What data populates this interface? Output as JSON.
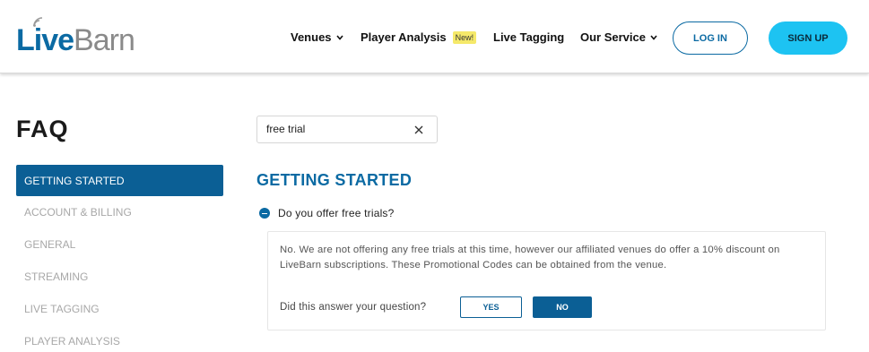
{
  "header": {
    "logo": {
      "part1": "Live",
      "part2": "Barn"
    },
    "nav": [
      {
        "label": "Venues",
        "has_dropdown": true
      },
      {
        "label": "Player Analysis",
        "badge": "New!"
      },
      {
        "label": "Live Tagging"
      },
      {
        "label": "Our Service",
        "has_dropdown": true
      }
    ],
    "login_label": "LOG IN",
    "signup_label": "SIGN UP"
  },
  "faq": {
    "title": "FAQ",
    "menu": [
      {
        "label": "GETTING STARTED",
        "active": true
      },
      {
        "label": "ACCOUNT & BILLING"
      },
      {
        "label": "GENERAL"
      },
      {
        "label": "STREAMING"
      },
      {
        "label": "LIVE TAGGING"
      },
      {
        "label": "PLAYER ANALYSIS"
      }
    ]
  },
  "search": {
    "value": "free trial",
    "clear_icon": "close-icon"
  },
  "section": {
    "title": "GETTING STARTED",
    "question": "Do you offer free trials?",
    "answer": "No. We are not offering any free trials at this time, however our affiliated venues do offer a 10% discount on LiveBarn subscriptions. These Promotional Codes can be obtained from the venue.",
    "feedback_label": "Did this answer your question?",
    "yes_label": "YES",
    "no_label": "NO"
  },
  "colors": {
    "brand_blue": "#0b6aa3",
    "active_blue": "#0b5f95",
    "signup_cyan": "#1dc3f2",
    "badge_yellow": "#f5e96a"
  }
}
